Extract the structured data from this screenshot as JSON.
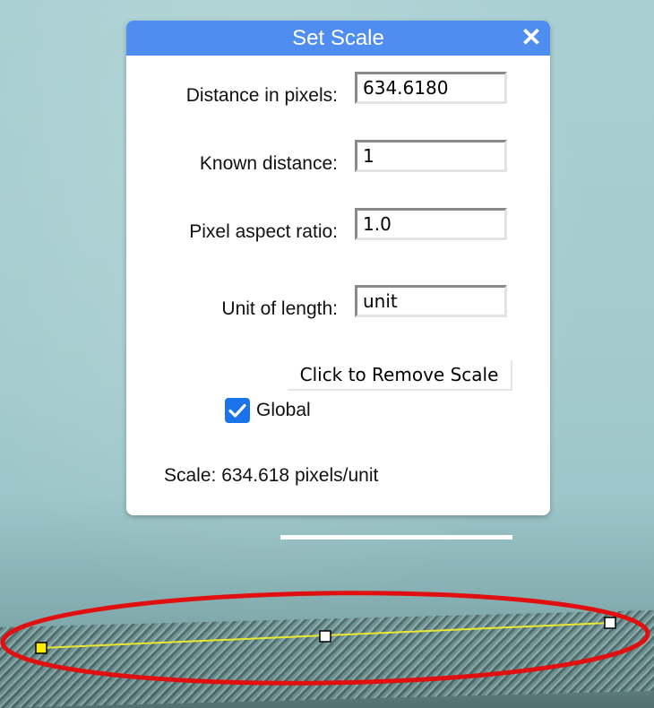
{
  "dialog": {
    "title": "Set Scale",
    "close_icon": "close-icon",
    "fields": [
      {
        "label": "Distance in pixels:",
        "value": "634.6180"
      },
      {
        "label": "Known distance:",
        "value": "1"
      },
      {
        "label": "Pixel aspect ratio:",
        "value": "1.0"
      },
      {
        "label": "Unit of length:",
        "value": "unit"
      }
    ],
    "remove_button_label": "Click to Remove Scale",
    "global": {
      "label": "Global",
      "checked": true
    },
    "scale_text": "Scale: 634.618 pixels/unit"
  },
  "overlay": {
    "measure_line_color": "#e8e830",
    "ellipse_color": "#e01010",
    "handle_start_color": "#ffee00",
    "handle_color": "#ffffff"
  }
}
